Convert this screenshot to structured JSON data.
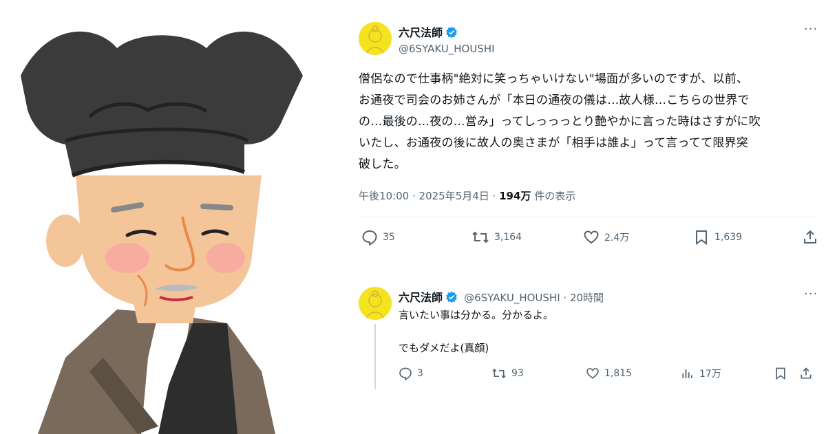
{
  "main_tweet": {
    "display_name": "六尺法師",
    "handle": "@6SYAKU_HOUSHI",
    "more": "···",
    "text_lines": [
      "僧侶なので仕事柄\"絶対に笑っちゃいけない\"場面が多いのですが、以前、",
      "お通夜で司会のお姉さんが「本日の通夜の儀は…故人様…こちらの世界で",
      "の…最後の…夜の…営み」ってしっっっとり艶やかに言った時はさすがに吹",
      "いたし、お通夜の後に故人の奥さまが「相手は誰よ」って言ってて限界突",
      "破した。"
    ],
    "timestamp": "午後10:00 · 2025年5月4日 · ",
    "views_count": "194万",
    "views_label": " 件の表示",
    "actions": {
      "replies": "35",
      "retweets": "3,164",
      "likes": "2.4万",
      "bookmarks": "1,639"
    }
  },
  "reply_tweet": {
    "display_name": "六尺法師",
    "handle_time": "@6SYAKU_HOUSHI · 20時間",
    "more": "···",
    "line1": "言いたい事は分かる。分かるよ。",
    "line2": "でもダメだよ(真顔)",
    "actions": {
      "replies": "3",
      "retweets": "93",
      "likes": "1,815",
      "views": "17万"
    }
  },
  "colors": {
    "verified_badge": "#1d9bf0",
    "avatar_bg": "#f4e41e",
    "muted_text": "#536471",
    "hat": "#3b3b3b",
    "skin": "#f5c59a",
    "robe": "#7a6a5c"
  },
  "icons": [
    "reply-icon",
    "retweet-icon",
    "like-icon",
    "bookmark-icon",
    "share-icon",
    "views-icon",
    "verified-icon",
    "more-icon"
  ]
}
